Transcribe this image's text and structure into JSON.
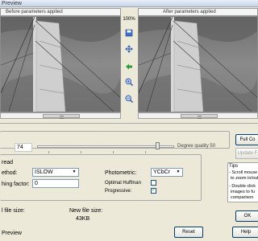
{
  "window": {
    "title": "Preview"
  },
  "preview": {
    "before_label": "Before parameters applied",
    "after_label": "After parameters applied",
    "zoom": "100%"
  },
  "quality": {
    "value": "74",
    "caption": "Degree quality 50"
  },
  "settings": {
    "section_label": "read",
    "method_label": "ethod:",
    "method_value": "ISLOW",
    "smoothing_label": "hing factor:",
    "smoothing_value": "0",
    "photometric_label": "Photometric:",
    "photometric_value": "YCbCr",
    "optimal_huffman_label": "Optimal Huffman",
    "progressive_label": "Progressive:",
    "progressive_checked": true,
    "optimal_huffman_checked": false
  },
  "sizes": {
    "file_size_label": "l file size:",
    "new_file_size_label": "New file size:",
    "new_file_size_value": "43KB"
  },
  "buttons": {
    "full_compare": "Full Co",
    "update": "Update F",
    "reset": "Reset",
    "help": "Help",
    "ok": "OK"
  },
  "tips": {
    "title": "Tips",
    "line1": "- Scroll mouse",
    "line2": "to zoom in/out",
    "line3": "- Double click",
    "line4": "images to fu",
    "line5": "comparison"
  },
  "footer": {
    "preview_label": "Preview"
  },
  "icons": {
    "tool1": "save-icon",
    "tool2": "move-icon",
    "tool3": "arrow-left-icon",
    "tool4": "zoom-in-icon",
    "tool5": "zoom-out-icon"
  }
}
